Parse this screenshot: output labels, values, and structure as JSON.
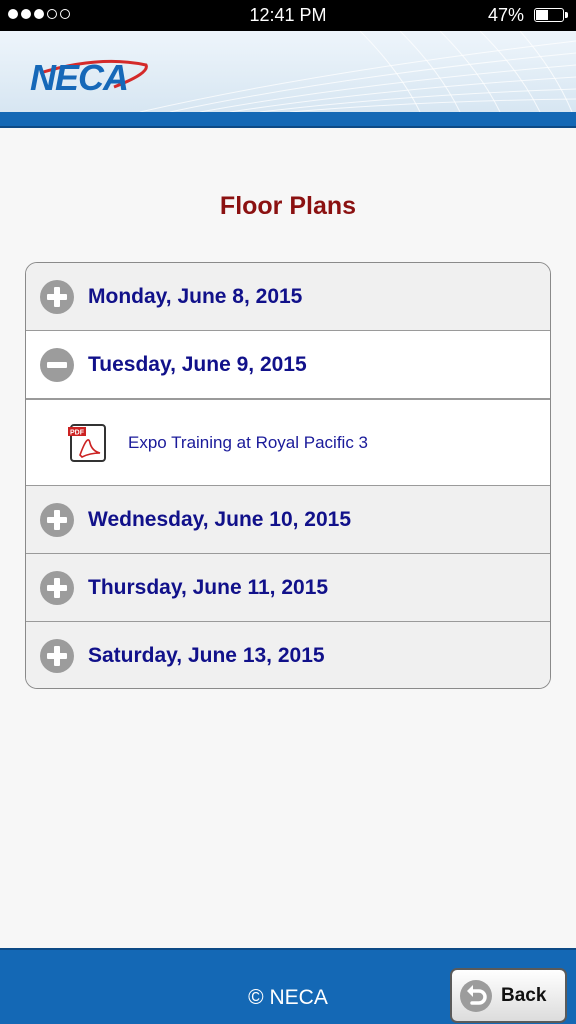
{
  "status_bar": {
    "time": "12:41 PM",
    "battery_percent": "47%",
    "signal_bars_filled": 3,
    "signal_bars_total": 5
  },
  "header": {
    "logo_text": "NECA",
    "colors": {
      "logo_blue": "#1668b8",
      "swoosh_red": "#d42a2a",
      "bar_blue": "#1468b5"
    }
  },
  "main": {
    "title": "Floor Plans",
    "title_color": "#8b1111",
    "days": [
      {
        "label": "Monday, June 8, 2015",
        "expanded": false,
        "icon": "plus-icon"
      },
      {
        "label": "Tuesday, June 9, 2015",
        "expanded": true,
        "icon": "minus-icon",
        "files": [
          {
            "label": "Expo Training at Royal Pacific 3",
            "icon": "pdf-icon"
          }
        ]
      },
      {
        "label": "Wednesday, June 10, 2015",
        "expanded": false,
        "icon": "plus-icon"
      },
      {
        "label": "Thursday, June 11, 2015",
        "expanded": false,
        "icon": "plus-icon"
      },
      {
        "label": "Saturday, June 13, 2015",
        "expanded": false,
        "icon": "plus-icon"
      }
    ]
  },
  "footer": {
    "copyright": "© NECA",
    "back_label": "Back",
    "back_icon": "undo-arrow-icon"
  }
}
